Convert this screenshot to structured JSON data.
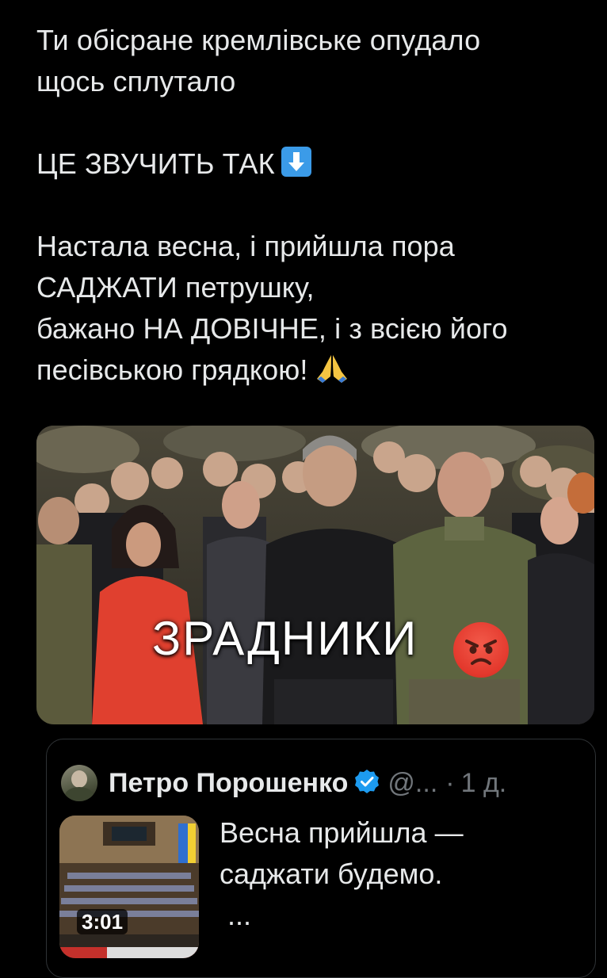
{
  "tweet": {
    "lines_block1": [
      "Ти обісране кремлівське опудало",
      "щось сплутало"
    ],
    "line_block2": "ЦЕ ЗВУЧИТЬ ТАК",
    "lines_block3": [
      "Настала весна, і прийшла пора",
      "САДЖАТИ петрушку,",
      "бажано НА ДОВІЧНЕ, і з всією його",
      "песівською грядкою!"
    ],
    "emoji_after_block2": "down-arrow-icon",
    "emoji_after_block3": "folded-hands-icon"
  },
  "media": {
    "caption": "ЗРАДНИКИ",
    "caption_emoji": "angry-face-icon"
  },
  "quote": {
    "name": "Петро Порошенко",
    "handle": "@...",
    "separator": "·",
    "time": "1 д.",
    "text_lines": [
      "Весна прийшла —",
      "саджати будемо."
    ],
    "more": "...",
    "video_duration": "3:01",
    "verified_color": "#1d9bf0"
  },
  "colors": {
    "background": "#000000",
    "text": "#e7e9ea",
    "muted": "#71767b",
    "border": "#2f3336"
  }
}
